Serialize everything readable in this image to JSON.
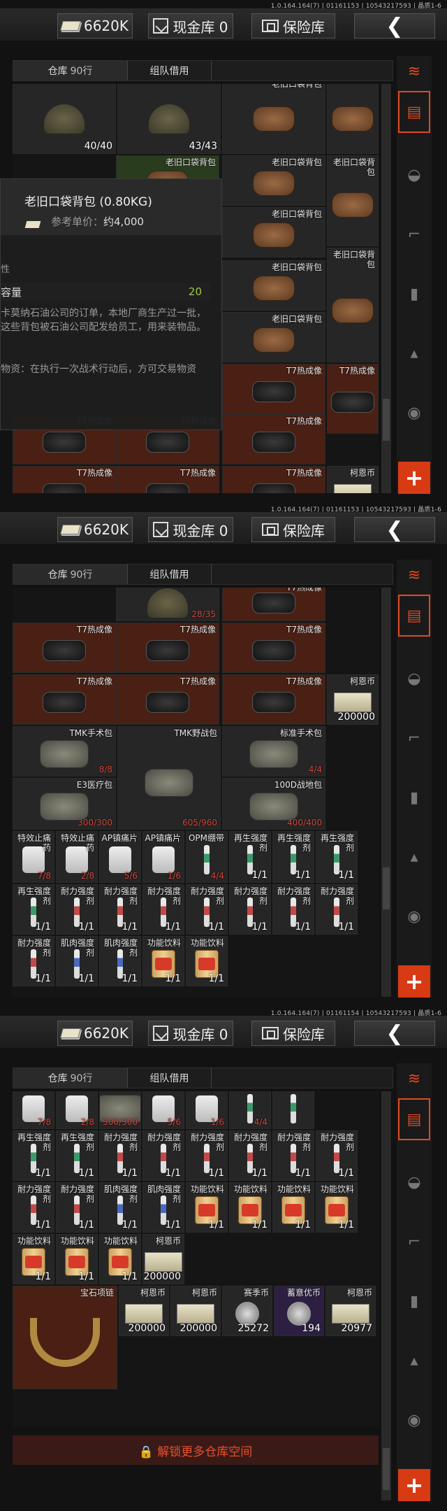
{
  "version": [
    "1.0.164.164(7) | 01161153 | 10543217593 | 晶质1-6",
    "1.0.164.164(7) | 01161153 | 10543217593 | 晶质1-6",
    "1.0.164.164(7) | 01161154 | 10543217593 | 晶质1-6"
  ],
  "topbar": {
    "money": "6620K",
    "cash_vault": "现金库 0",
    "safe_box": "保险库",
    "back": "❮"
  },
  "tabs": {
    "warehouse": "仓库",
    "rows": "90行",
    "team": "组队借用"
  },
  "tooltip": {
    "title": "老旧口袋背包 (0.80KG)",
    "price_label": "参考单价：",
    "price_value": "约4,000",
    "small_label": "性",
    "capacity_label": "容量",
    "capacity_value": "20",
    "desc": "卡莫纳石油公司的订单，本地厂商生产过一批，这些背包被石油公司配发给员工，用来装物品。",
    "note": "物资：在执行一次战术行动后，方可交易物资"
  },
  "panel1_cells": [
    {
      "name": "",
      "count": "40/40",
      "icon": "helmet"
    },
    {
      "name": "",
      "count": "43/43",
      "icon": "helmet"
    },
    {
      "name": "老旧口袋背包",
      "count": "",
      "icon": "bag"
    },
    {
      "name": "",
      "count": "",
      "icon": "bag"
    },
    {
      "name": "老旧口袋背包",
      "count": "",
      "icon": "bag"
    },
    {
      "name": "老旧口袋背包",
      "count": "",
      "icon": "bag"
    },
    {
      "name": "老旧口袋背包",
      "count": "",
      "icon": "bag"
    },
    {
      "name": "老旧口袋背包",
      "count": "",
      "icon": "bag"
    },
    {
      "name": "老旧口袋背包",
      "count": "",
      "icon": "bag"
    },
    {
      "name": "老旧口袋背包",
      "count": "",
      "icon": "bag"
    },
    {
      "name": "老旧口袋背包",
      "count": "",
      "icon": "bag"
    },
    {
      "name": "T7热成像",
      "count": "",
      "icon": "thermal"
    },
    {
      "name": "T7热成像",
      "count": "",
      "icon": "thermal"
    },
    {
      "name": "T7热成像",
      "count": "",
      "icon": "thermal"
    },
    {
      "name": "T7热成像",
      "count": "",
      "icon": "thermal"
    },
    {
      "name": "T7热成像",
      "count": "",
      "icon": "thermal"
    },
    {
      "name": "T7热成像",
      "count": "",
      "icon": "thermal"
    },
    {
      "name": "T7热成像",
      "count": "",
      "icon": "thermal"
    },
    {
      "name": "T7热成像",
      "count": "",
      "icon": "thermal"
    },
    {
      "name": "柯恩币",
      "count": "",
      "icon": "money"
    }
  ],
  "panel2_cells": [
    {
      "name": "",
      "count": "28/35",
      "icon": "helmet"
    },
    {
      "name": "T7热成像",
      "count": "",
      "icon": "thermal"
    },
    {
      "name": "T7热成像",
      "count": "",
      "icon": "thermal"
    },
    {
      "name": "T7热成像",
      "count": "",
      "icon": "thermal"
    },
    {
      "name": "T7热成像",
      "count": "",
      "icon": "thermal"
    },
    {
      "name": "T7热成像",
      "count": "",
      "icon": "thermal"
    },
    {
      "name": "T7热成像",
      "count": "",
      "icon": "thermal"
    },
    {
      "name": "T7热成像",
      "count": "",
      "icon": "thermal"
    },
    {
      "name": "柯恩币",
      "count": "200000",
      "icon": "money"
    },
    {
      "name": "TMK手术包",
      "count": "8/8",
      "icon": "medbag"
    },
    {
      "name": "TMK野战包",
      "count": "605/960",
      "icon": "medbag"
    },
    {
      "name": "标准手术包",
      "count": "4/4",
      "icon": "medbag"
    },
    {
      "name": "E3医疗包",
      "count": "300/300",
      "icon": "medbag"
    },
    {
      "name": "E3医疗包",
      "count": "300/300",
      "icon": "medbag"
    },
    {
      "name": "100D战地包",
      "count": "400/400",
      "icon": "medbag"
    },
    {
      "name": "特效止痛药",
      "count": "7/8",
      "icon": "jar"
    },
    {
      "name": "特效止痛药",
      "count": "2/8",
      "icon": "jar"
    },
    {
      "name": "AP镇痛片",
      "count": "5/6",
      "icon": "jar"
    },
    {
      "name": "AP镇痛片",
      "count": "1/6",
      "icon": "jar"
    },
    {
      "name": "OPM绷带",
      "count": "4/4",
      "icon": "rod"
    },
    {
      "name": "再生强度剂",
      "count": "1/1",
      "icon": "rod"
    },
    {
      "name": "再生强度剂",
      "count": "1/1",
      "icon": "rod"
    },
    {
      "name": "再生强度剂",
      "count": "1/1",
      "icon": "rod"
    },
    {
      "name": "再生强度剂",
      "count": "1/1",
      "icon": "rod"
    },
    {
      "name": "耐力强度剂",
      "count": "1/1",
      "icon": "rodred"
    },
    {
      "name": "耐力强度剂",
      "count": "1/1",
      "icon": "rodred"
    },
    {
      "name": "耐力强度剂",
      "count": "1/1",
      "icon": "rodred"
    },
    {
      "name": "耐力强度剂",
      "count": "1/1",
      "icon": "rodred"
    },
    {
      "name": "耐力强度剂",
      "count": "1/1",
      "icon": "rodred"
    },
    {
      "name": "耐力强度剂",
      "count": "1/1",
      "icon": "rodred"
    },
    {
      "name": "耐力强度剂",
      "count": "1/1",
      "icon": "rodred"
    },
    {
      "name": "耐力强度剂",
      "count": "1/1",
      "icon": "rodred"
    },
    {
      "name": "肌肉强度剂",
      "count": "1/1",
      "icon": "rodblue"
    },
    {
      "name": "肌肉强度剂",
      "count": "1/1",
      "icon": "rodblue"
    },
    {
      "name": "功能饮料",
      "count": "1/1",
      "icon": "can"
    },
    {
      "name": "功能饮料",
      "count": "1/1",
      "icon": "can"
    }
  ],
  "panel3_cells": [
    {
      "name": "",
      "count": "7/8",
      "icon": "jar"
    },
    {
      "name": "",
      "count": "2/8",
      "icon": "jar"
    },
    {
      "name": "",
      "count": "300/300",
      "icon": "medbag"
    },
    {
      "name": "",
      "count": "5/6",
      "icon": "jar"
    },
    {
      "name": "",
      "count": "1/6",
      "icon": "jar"
    },
    {
      "name": "",
      "count": "4/4",
      "icon": "rod"
    },
    {
      "name": "",
      "count": "",
      "icon": "rod"
    },
    {
      "name": "再生强度剂",
      "count": "1/1",
      "icon": "rod"
    },
    {
      "name": "再生强度剂",
      "count": "1/1",
      "icon": "rod"
    },
    {
      "name": "耐力强度剂",
      "count": "1/1",
      "icon": "rodred"
    },
    {
      "name": "耐力强度剂",
      "count": "1/1",
      "icon": "rodred"
    },
    {
      "name": "耐力强度剂",
      "count": "1/1",
      "icon": "rodred"
    },
    {
      "name": "耐力强度剂",
      "count": "1/1",
      "icon": "rodred"
    },
    {
      "name": "耐力强度剂",
      "count": "1/1",
      "icon": "rodred"
    },
    {
      "name": "耐力强度剂",
      "count": "1/1",
      "icon": "rodred"
    },
    {
      "name": "耐力强度剂",
      "count": "1/1",
      "icon": "rodred"
    },
    {
      "name": "耐力强度剂",
      "count": "1/1",
      "icon": "rodred"
    },
    {
      "name": "肌肉强度剂",
      "count": "1/1",
      "icon": "rodblue"
    },
    {
      "name": "肌肉强度剂",
      "count": "1/1",
      "icon": "rodblue"
    },
    {
      "name": "功能饮料",
      "count": "1/1",
      "icon": "can"
    },
    {
      "name": "功能饮料",
      "count": "1/1",
      "icon": "can"
    },
    {
      "name": "功能饮料",
      "count": "1/1",
      "icon": "can"
    },
    {
      "name": "功能饮料",
      "count": "1/1",
      "icon": "can"
    },
    {
      "name": "功能饮料",
      "count": "1/1",
      "icon": "can"
    },
    {
      "name": "功能饮料",
      "count": "1/1",
      "icon": "can"
    },
    {
      "name": "功能饮料",
      "count": "1/1",
      "icon": "can"
    },
    {
      "name": "柯恩币",
      "count": "200000",
      "icon": "money"
    },
    {
      "name": "宝石项链",
      "count": "",
      "icon": "necklace"
    },
    {
      "name": "柯恩币",
      "count": "200000",
      "icon": "money"
    },
    {
      "name": "柯恩币",
      "count": "200000",
      "icon": "money"
    },
    {
      "name": "赛季币",
      "count": "25272",
      "icon": "coin"
    },
    {
      "name": "蓄意优币",
      "count": "194",
      "icon": "coin"
    },
    {
      "name": "柯恩币",
      "count": "20977",
      "icon": "money"
    }
  ],
  "unlock_label": "🔒 解锁更多仓库空间",
  "colors": {
    "accent": "#e04a24",
    "capacity_green": "#9ac848",
    "count_red": "#d0453a"
  }
}
